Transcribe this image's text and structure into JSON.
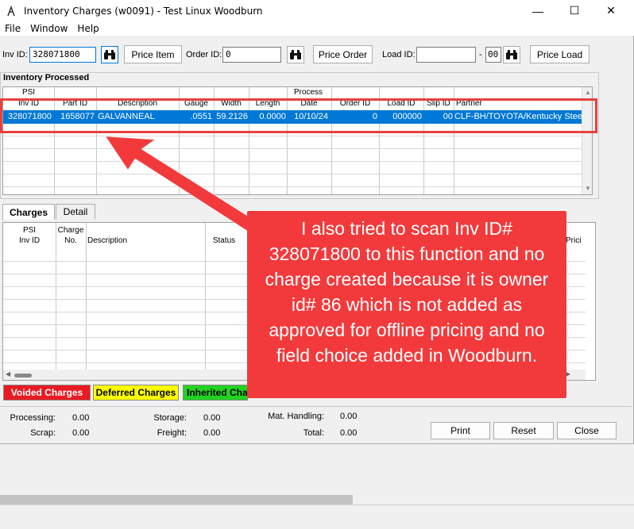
{
  "window": {
    "title": "Inventory Charges (w0091) - Test Linux Woodburn",
    "minimize": "—",
    "maximize": "☐",
    "close": "✕"
  },
  "menu": [
    "File",
    "Window",
    "Help"
  ],
  "toolbar": {
    "inv_id_label": "Inv ID:",
    "inv_id_value": "328071800",
    "price_item": "Price Item",
    "order_id_label": "Order ID:",
    "order_id_value": "0",
    "price_order": "Price Order",
    "load_id_label": "Load ID:",
    "load_id_value": "",
    "load_dash": "-",
    "load_suffix": "00",
    "price_load": "Price Load"
  },
  "inventory": {
    "title": "Inventory Processed",
    "headers_top": [
      "PSI",
      "",
      "",
      "",
      "",
      "",
      "Process",
      "",
      "",
      "",
      ""
    ],
    "headers": [
      "Inv ID",
      "Part ID",
      "Description",
      "Gauge",
      "Width",
      "Length",
      "Date",
      "Order ID",
      "Load ID",
      "Slip ID",
      "Partner"
    ],
    "row": [
      "328071800",
      "1658077",
      "GALVANNEAL",
      ".0551",
      "59.2126",
      "0.0000",
      "10/10/24",
      "0",
      "000000",
      "00",
      "CLF-BH/TOYOTA/Kentucky Stee"
    ]
  },
  "tabs": [
    "Charges",
    "Detail"
  ],
  "charges": {
    "headers_top": [
      "PSI",
      "Charge",
      "",
      ""
    ],
    "headers": [
      "Inv ID",
      "No.",
      "Description",
      "Status"
    ],
    "right_partial": "Prici"
  },
  "legend": [
    "Voided Charges",
    "Deferred Charges",
    "Inherited Cha"
  ],
  "totals": {
    "processing_label": "Processing:",
    "processing": "0.00",
    "scrap_label": "Scrap:",
    "scrap": "0.00",
    "storage_label": "Storage:",
    "storage": "0.00",
    "freight_label": "Freight:",
    "freight": "0.00",
    "mat_label": "Mat. Handling:",
    "mat": "0.00",
    "total_label": "Total:",
    "total": "0.00"
  },
  "buttons": {
    "print": "Print",
    "reset": "Reset",
    "close": "Close"
  },
  "annotation": "I also tried to scan Inv ID# 328071800 to this function and no charge created because it is owner id# 86 which is not added as approved for offline pricing and no field choice added in Woodburn.",
  "colors": {
    "selection": "#0078d7",
    "voided": "#e81b23",
    "deferred": "#ffff00",
    "inherited": "#22d322",
    "callout": "#f23a3c"
  }
}
